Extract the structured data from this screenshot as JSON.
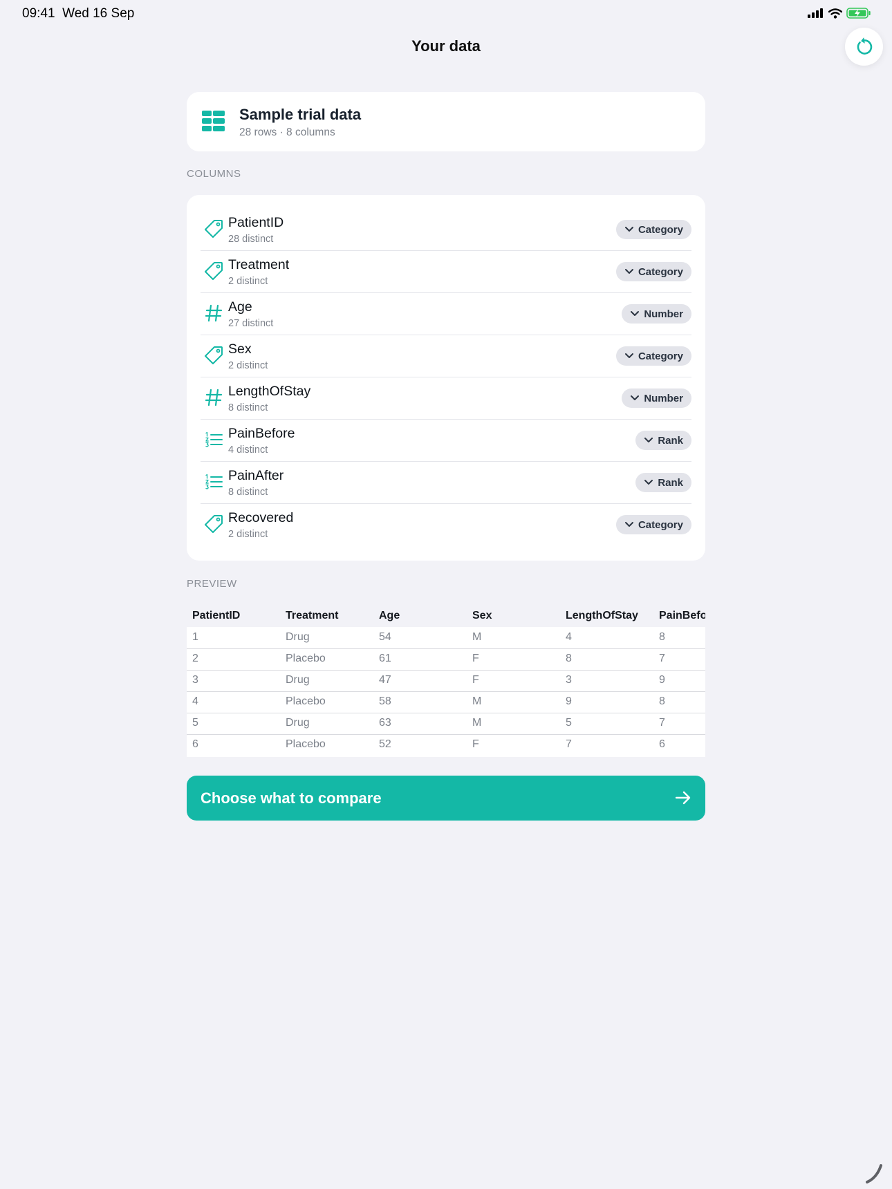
{
  "status_bar": {
    "time": "09:41",
    "date": "Wed 16 Sep"
  },
  "nav": {
    "title": "Your data",
    "reset_icon": "reset-icon"
  },
  "dataset": {
    "name": "Sample trial data",
    "meta": "28 rows · 8 columns",
    "icon": "table-icon"
  },
  "columns_section": {
    "label": "COLUMNS",
    "items": [
      {
        "name": "PatientID",
        "distinct": "28 distinct",
        "type": "Category",
        "icon": "tag-icon"
      },
      {
        "name": "Treatment",
        "distinct": "2 distinct",
        "type": "Category",
        "icon": "tag-icon"
      },
      {
        "name": "Age",
        "distinct": "27 distinct",
        "type": "Number",
        "icon": "hash-icon"
      },
      {
        "name": "Sex",
        "distinct": "2 distinct",
        "type": "Category",
        "icon": "tag-icon"
      },
      {
        "name": "LengthOfStay",
        "distinct": "8 distinct",
        "type": "Number",
        "icon": "hash-icon"
      },
      {
        "name": "PainBefore",
        "distinct": "4 distinct",
        "type": "Rank",
        "icon": "ordered-list-icon"
      },
      {
        "name": "PainAfter",
        "distinct": "8 distinct",
        "type": "Rank",
        "icon": "ordered-list-icon"
      },
      {
        "name": "Recovered",
        "distinct": "2 distinct",
        "type": "Category",
        "icon": "tag-icon"
      }
    ]
  },
  "preview_section": {
    "label": "PREVIEW",
    "headers": [
      "PatientID",
      "Treatment",
      "Age",
      "Sex",
      "LengthOfStay",
      "PainBefore"
    ],
    "rows": [
      [
        "1",
        "Drug",
        "54",
        "M",
        "4",
        "8"
      ],
      [
        "2",
        "Placebo",
        "61",
        "F",
        "8",
        "7"
      ],
      [
        "3",
        "Drug",
        "47",
        "F",
        "3",
        "9"
      ],
      [
        "4",
        "Placebo",
        "58",
        "M",
        "9",
        "8"
      ],
      [
        "5",
        "Drug",
        "63",
        "M",
        "5",
        "7"
      ],
      [
        "6",
        "Placebo",
        "52",
        "F",
        "7",
        "6"
      ]
    ]
  },
  "cta": {
    "label": "Choose what to compare",
    "icon": "arrow-right-icon"
  },
  "colors": {
    "accent": "#14b8a6",
    "background": "#f2f2f7"
  }
}
